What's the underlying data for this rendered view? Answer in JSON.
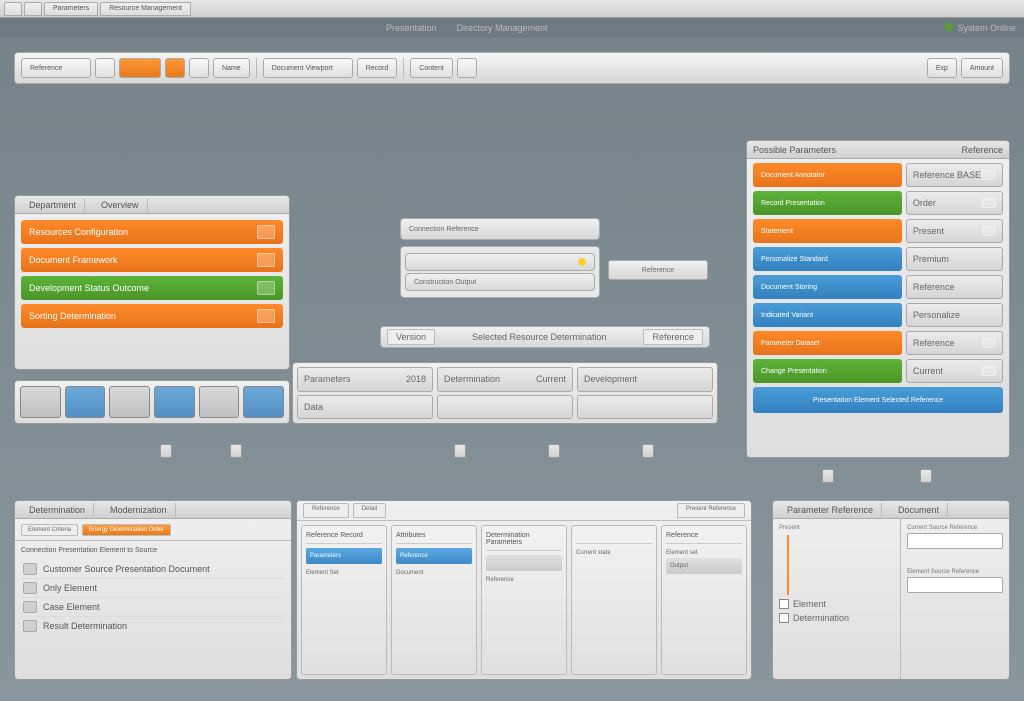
{
  "tabs": [
    "",
    "",
    "Parameters",
    "Resource Management"
  ],
  "menu": {
    "items": [
      "Presentation",
      "Directory Management"
    ],
    "status": "System Online"
  },
  "toolbar": {
    "search_label": "Reference",
    "orange_label": "",
    "btn1": "Name",
    "btn2": "Document Viewport",
    "btn3": "Record",
    "btn4": "Content",
    "btn_exp": "Exp",
    "btn_amount": "Amount"
  },
  "left_panel": {
    "tab1": "Department",
    "tab2": "Overview",
    "bars": [
      {
        "color": "orange",
        "label": "Resources Configuration"
      },
      {
        "color": "orange",
        "label": "Document Framework"
      },
      {
        "color": "green",
        "label": "Development Status Outcome"
      },
      {
        "color": "orange",
        "label": "Sorting Determination"
      }
    ]
  },
  "center": {
    "nodes": [
      "Connection Reference",
      "",
      "Construction Output"
    ],
    "side_node": "Reference",
    "readout": {
      "seg1": "Version",
      "main": "Selected Resource Determination",
      "seg2": "Reference"
    }
  },
  "grid": {
    "cells": [
      [
        "Parameters",
        "2018",
        "Determination",
        "Current",
        "Development",
        ""
      ],
      [
        "Data",
        "",
        "",
        "",
        "",
        ""
      ]
    ]
  },
  "right_panel": {
    "header_left": "Possible Parameters",
    "header_right": "Reference",
    "rows": [
      {
        "main_color": "orange",
        "main": "Document Annotator",
        "side": "Reference\nBASE"
      },
      {
        "main_color": "green",
        "main": "Record Presentation",
        "side": "Order"
      },
      {
        "main_color": "orange",
        "main": "Statement",
        "side": "Present"
      },
      {
        "main_color": "blue",
        "main": "Personalize Standard",
        "side": "Premium"
      },
      {
        "main_color": "blue",
        "main": "Document Storing",
        "side": "Reference"
      },
      {
        "main_color": "blue",
        "main": "Indicated Variant",
        "side": "Personalize"
      },
      {
        "main_color": "orange",
        "main": "Parameter Dataset",
        "side": "Reference"
      },
      {
        "main_color": "green",
        "main": "Change Presentation",
        "side": "Current"
      }
    ],
    "wide_btn": "Presentation Element Selected Reference"
  },
  "bottom_left": {
    "tab1": "Determination",
    "tab2": "Modernization",
    "seg1": "Element Criteria",
    "seg2": "Energy Determination Order",
    "heading": "Connection Presentation\nElement to Source",
    "items": [
      "Customer Source Presentation Document",
      "Only Element",
      "Case Element",
      "Result Determination"
    ]
  },
  "bottom_center": {
    "tabs": [
      "Reference",
      "Detail",
      "Present Reference"
    ],
    "cols": [
      {
        "head": "Reference\nRecord",
        "items": [
          "Parameters",
          "Element Set",
          ""
        ]
      },
      {
        "head": "Attributes",
        "items": [
          "Reference",
          "Document",
          ""
        ]
      },
      {
        "head": "Determination\nParameters",
        "items": [
          "",
          "Reference"
        ]
      },
      {
        "head": "",
        "items": [
          "Current state",
          ""
        ]
      },
      {
        "head": "Reference",
        "items": [
          "Element set",
          "Output"
        ]
      }
    ]
  },
  "bottom_right": {
    "tab1": "Parameter Reference",
    "tab2": "Document",
    "left_label": "Present",
    "checks": [
      "Element",
      "Determination"
    ],
    "right_label": "Current Source Reference",
    "right_label2": "Element Source Reference"
  },
  "colors": {
    "orange": "#f08228",
    "green": "#52a530",
    "blue": "#3f8ac8"
  }
}
